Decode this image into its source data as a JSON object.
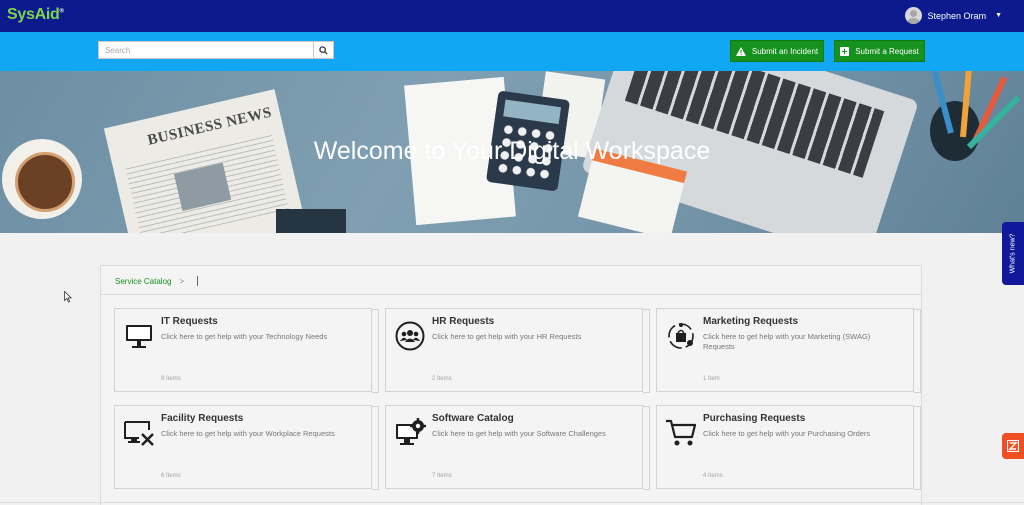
{
  "app": {
    "logo_text": "SysAid",
    "logo_mark": "®"
  },
  "user": {
    "name": "Stephen Oram"
  },
  "search": {
    "placeholder": "Search"
  },
  "actions": {
    "incident_label": "Submit an Incident",
    "request_label": "Submit a Request"
  },
  "hero": {
    "title": "Welcome to Your Digital Workspace",
    "newspaper_text": "BUSINESS NEWS"
  },
  "breadcrumb": {
    "root": "Service Catalog",
    "separator": ">"
  },
  "categories": [
    {
      "title": "IT Requests",
      "description": "Click here to get help with your Technology Needs",
      "count": "8 Items",
      "icon": "monitor-icon"
    },
    {
      "title": "HR Requests",
      "description": "Click here to get help with your HR Requests",
      "count": "2 Items",
      "icon": "people-group-icon"
    },
    {
      "title": "Marketing Requests",
      "description": "Click here to get help with your Marketing (SWAG) Requests",
      "count": "1 Item",
      "icon": "shopping-bag-cycle-icon"
    },
    {
      "title": "Facility Requests",
      "description": "Click here to get help with your Workplace Requests",
      "count": "6 Items",
      "icon": "screen-tools-icon"
    },
    {
      "title": "Software Catalog",
      "description": "Click here to get help with your Software Challenges",
      "count": "7 Items",
      "icon": "monitor-gear-icon"
    },
    {
      "title": "Purchasing Requests",
      "description": "Click here to get help with your Purchasing Orders",
      "count": "4 Items",
      "icon": "shopping-cart-icon"
    }
  ],
  "widgets": {
    "whats_new": "What's new?"
  },
  "colors": {
    "topbar": "#0c1a8e",
    "bluebar": "#11a7f2",
    "primary_button": "#15911d",
    "accent_float": "#f04e23"
  }
}
